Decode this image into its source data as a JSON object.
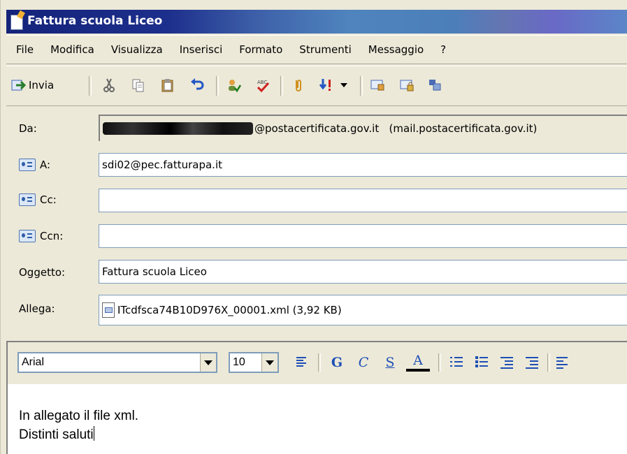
{
  "window": {
    "title": "Fattura scuola Liceo"
  },
  "menu": [
    "File",
    "Modifica",
    "Visualizza",
    "Inserisci",
    "Formato",
    "Strumenti",
    "Messaggio",
    "?"
  ],
  "toolbar": {
    "send_label": "Invia",
    "icons": [
      "send-icon",
      "cut-icon",
      "copy-icon",
      "paste-icon",
      "undo-icon",
      "check-names-icon",
      "spelling-icon",
      "attach-icon",
      "priority-icon",
      "sign-icon",
      "encrypt-icon",
      "offline-icon"
    ]
  },
  "headers": {
    "from_label": "Da:",
    "from_value": "@postacertificata.gov.it   (mail.postacertificata.gov.it)",
    "to_label": "A:",
    "to_value": "sdi02@pec.fatturapa.it",
    "cc_label": "Cc:",
    "cc_value": "",
    "bcc_label": "Ccn:",
    "bcc_value": "",
    "subject_label": "Oggetto:",
    "subject_value": "Fattura scuola Liceo",
    "attach_label": "Allega:",
    "attachment": "ITcdfsca74B10D976X_00001.xml (3,92 KB)"
  },
  "format": {
    "font": "Arial",
    "size": "10",
    "bold": "G",
    "italic": "C",
    "underline": "S",
    "color": "A"
  },
  "body": {
    "line1": "In allegato il file xml.",
    "line2": "Distinti saluti"
  }
}
